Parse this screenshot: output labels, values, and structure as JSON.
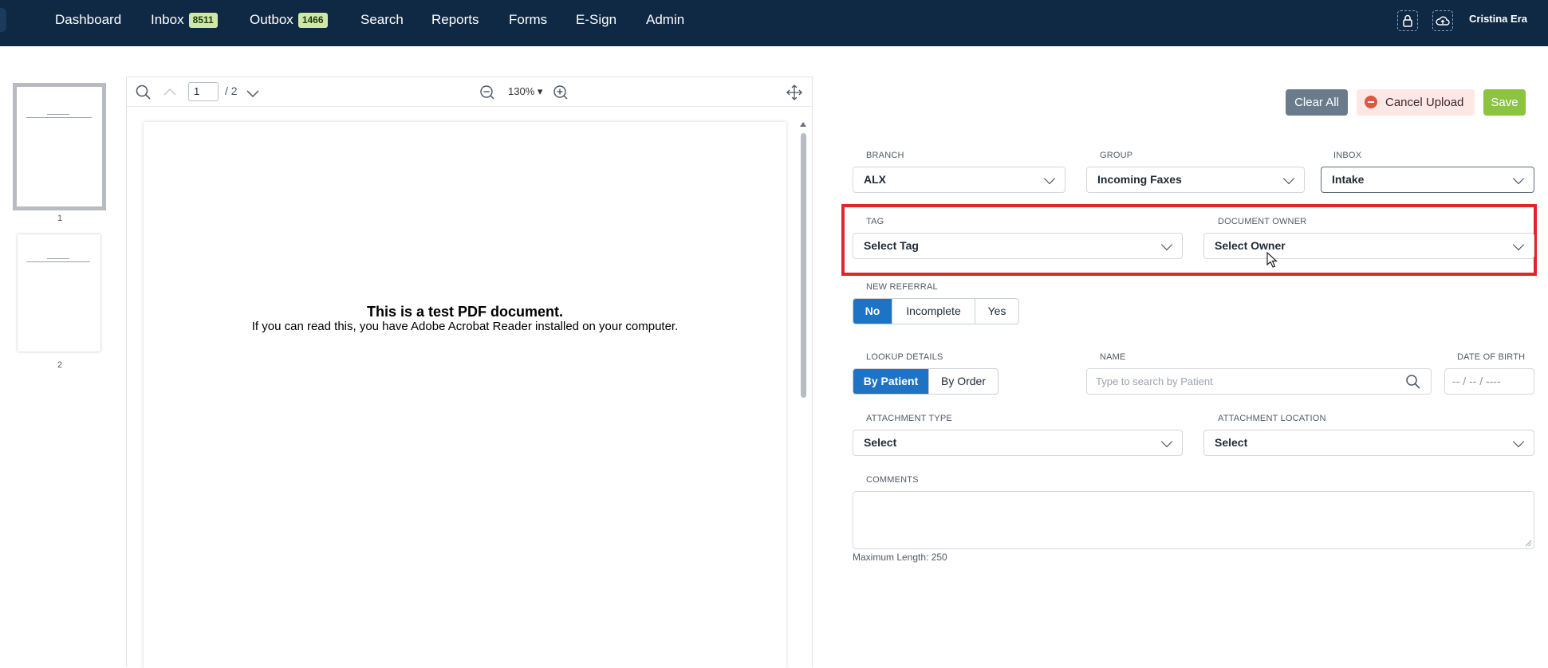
{
  "nav": {
    "items": [
      {
        "label": "Dashboard"
      },
      {
        "label": "Inbox",
        "badge": "8511"
      },
      {
        "label": "Outbox",
        "badge": "1466"
      },
      {
        "label": "Search"
      },
      {
        "label": "Reports"
      },
      {
        "label": "Forms"
      },
      {
        "label": "E-Sign"
      },
      {
        "label": "Admin"
      }
    ],
    "user": "Cristina Era",
    "icons": [
      "lock-icon",
      "cloud-upload-icon"
    ]
  },
  "thumbnails": [
    {
      "page": "1"
    },
    {
      "page": "2"
    }
  ],
  "viewer": {
    "current_page": "1",
    "total_pages": "/ 2",
    "zoom": "130% ▾",
    "doc_title": "This is a test PDF document.",
    "doc_subtitle": "If you can read this, you have Adobe Acrobat Reader installed on your computer."
  },
  "actions": {
    "clear_all": "Clear All",
    "cancel_upload": "Cancel Upload",
    "save": "Save"
  },
  "form": {
    "branch": {
      "label": "BRANCH",
      "value": "ALX"
    },
    "group": {
      "label": "GROUP",
      "value": "Incoming Faxes"
    },
    "inbox": {
      "label": "INBOX",
      "value": "Intake"
    },
    "tag": {
      "label": "TAG",
      "value": "Select Tag"
    },
    "document_owner": {
      "label": "DOCUMENT OWNER",
      "value": "Select Owner"
    },
    "new_referral": {
      "label": "NEW REFERRAL",
      "options": [
        "No",
        "Incomplete",
        "Yes"
      ],
      "selected": "No"
    },
    "lookup_details": {
      "label": "LOOKUP DETAILS",
      "options": [
        "By Patient",
        "By Order"
      ],
      "selected": "By Patient"
    },
    "name": {
      "label": "NAME",
      "placeholder": "Type to search by Patient"
    },
    "dob": {
      "label": "DATE OF BIRTH",
      "placeholder": "-- / -- / ----"
    },
    "attachment_type": {
      "label": "ATTACHMENT TYPE",
      "value": "Select"
    },
    "attachment_location": {
      "label": "ATTACHMENT LOCATION",
      "value": "Select"
    },
    "comments": {
      "label": "COMMENTS",
      "hint": "Maximum Length: 250"
    }
  },
  "colors": {
    "nav_bg": "#0f2844",
    "primary": "#1f73c4",
    "save": "#8cc43f",
    "highlight": "#e0262b"
  }
}
